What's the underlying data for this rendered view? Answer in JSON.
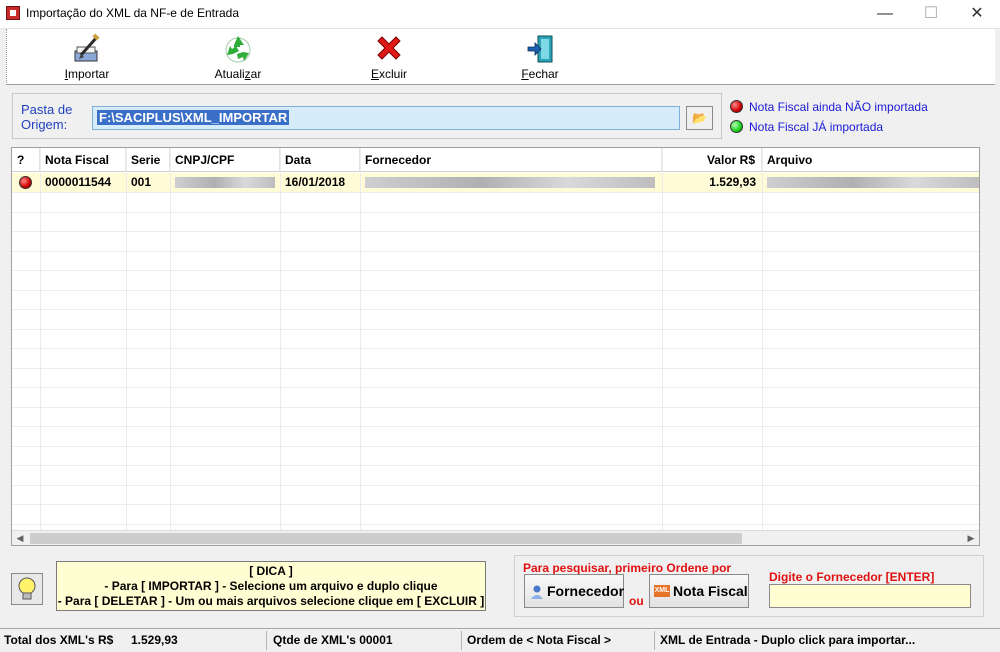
{
  "window": {
    "title": "Importação do XML da NF-e de Entrada",
    "minimize_glyph": "—",
    "maximize_glyph": "☐",
    "close_glyph": "✕"
  },
  "toolbar": {
    "importar": {
      "pre": "",
      "ul": "I",
      "post": "mportar",
      "icon": "import-pen-icon"
    },
    "atualizar": {
      "pre": "Atuali",
      "ul": "z",
      "post": "ar",
      "icon": "recycle-refresh-icon"
    },
    "excluir": {
      "pre": "",
      "ul": "E",
      "post": "xcluir",
      "icon": "red-x-delete-icon"
    },
    "fechar": {
      "pre": "",
      "ul": "F",
      "post": "echar",
      "icon": "exit-door-icon"
    }
  },
  "folder": {
    "label": "Pasta de Origem:",
    "value": "F:\\SACIPLUS\\XML_IMPORTAR",
    "browse_glyph": "📂"
  },
  "legend": {
    "not_imported": "Nota Fiscal ainda NÃO importada",
    "imported": "Nota Fiscal JÁ importada",
    "red": "#d00000",
    "green": "#1bd11b"
  },
  "grid": {
    "columns": [
      "?",
      "Nota Fiscal",
      "Serie",
      "CNPJ/CPF",
      "Data",
      "Fornecedor",
      "Valor R$",
      "Arquivo"
    ],
    "rows": [
      {
        "status": "not-imported",
        "nota_fiscal": "0000011544",
        "serie": "001",
        "data": "16/01/2018",
        "valor": "1.529,93"
      }
    ]
  },
  "tip": {
    "title": "[ DICA ]",
    "line1": "- Para [ IMPORTAR ] - Selecione um arquivo e duplo clique",
    "line2": "- Para [ DELETAR ] - Um ou mais arquivos selecione clique em [ EXCLUIR ]"
  },
  "search": {
    "hint": "Para pesquisar, primeiro Ordene por",
    "fornecedor_button": "Fornecedor",
    "nota_fiscal_button": "Nota Fiscal",
    "xml_badge": "XML",
    "or": "ou",
    "input_label": "Digite o Fornecedor [ENTER]",
    "input_value": ""
  },
  "status": {
    "total_label": "Total dos XML's R$",
    "total_value": "1.529,93",
    "qtde": "Qtde de XML's 00001",
    "ordem": "Ordem de < Nota Fiscal >",
    "hint": "XML de Entrada - Duplo click para importar..."
  }
}
